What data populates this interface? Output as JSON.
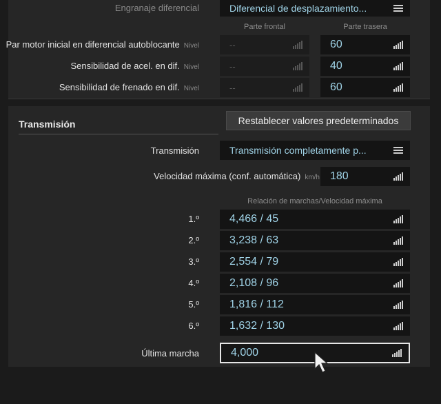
{
  "differential": {
    "gear_label": "Engranaje diferencial",
    "gear_value": "Diferencial de desplazamiento...",
    "col_front": "Parte frontal",
    "col_rear": "Parte trasera",
    "rows": [
      {
        "label": "Par motor inicial en diferencial autoblocante",
        "unit": "Nivel",
        "front": "--",
        "rear": "60"
      },
      {
        "label": "Sensibilidad de acel. en dif.",
        "unit": "Nivel",
        "front": "--",
        "rear": "40"
      },
      {
        "label": "Sensibilidad de frenado en dif.",
        "unit": "Nivel",
        "front": "--",
        "rear": "60"
      }
    ]
  },
  "transmission": {
    "title": "Transmisión",
    "reset_label": "Restablecer valores predeterminados",
    "type_label": "Transmisión",
    "type_value": "Transmisión completamente p...",
    "max_speed_label": "Velocidad máxima (conf. automática)",
    "max_speed_unit": "km/h",
    "max_speed_value": "180",
    "ratio_header": "Relación de marchas/Velocidad máxima",
    "gears": [
      {
        "label": "1.º",
        "value": "4,466 / 45"
      },
      {
        "label": "2.º",
        "value": "3,238 / 63"
      },
      {
        "label": "3.º",
        "value": "2,554 / 79"
      },
      {
        "label": "4.º",
        "value": "2,108 / 96"
      },
      {
        "label": "5.º",
        "value": "1,816 / 112"
      },
      {
        "label": "6.º",
        "value": "1,632 / 130"
      }
    ],
    "final_label": "Última marcha",
    "final_value": "4,000"
  },
  "icons": {
    "menu": "menu-icon",
    "signal": "signal-bars-icon",
    "cursor": "mouse-pointer-icon"
  },
  "colors": {
    "value_text": "#9fd2e6",
    "panel": "#262626",
    "field": "#141414"
  }
}
